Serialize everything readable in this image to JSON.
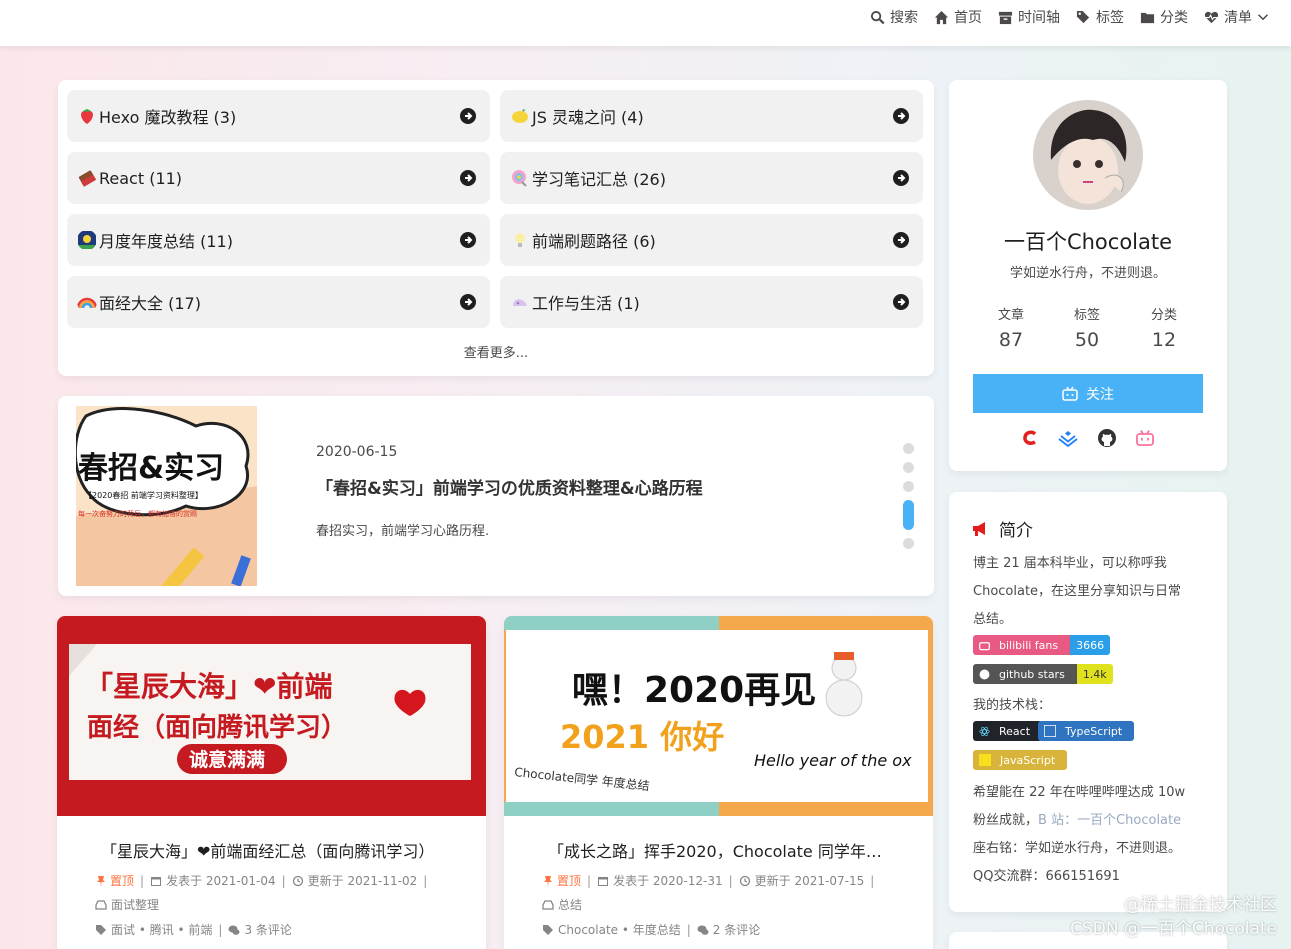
{
  "nav": {
    "items": [
      {
        "label": "搜索",
        "icon": "search-icon"
      },
      {
        "label": "首页",
        "icon": "home-icon"
      },
      {
        "label": "时间轴",
        "icon": "archive-icon"
      },
      {
        "label": "标签",
        "icon": "tags-icon"
      },
      {
        "label": "分类",
        "icon": "folder-icon"
      },
      {
        "label": "清单",
        "icon": "heartbeat-icon"
      }
    ]
  },
  "categories": {
    "items": [
      {
        "label": "Hexo 魔改教程 (3)",
        "icon": "strawberry-icon",
        "color": "#e8383d"
      },
      {
        "label": "JS 灵魂之问 (4)",
        "icon": "lemon-icon",
        "color": "#f5d33a"
      },
      {
        "label": "React (11)",
        "icon": "chocolate-icon",
        "color": "#8a4b2a"
      },
      {
        "label": "学习笔记汇总 (26)",
        "icon": "lollipop-icon",
        "color": "#e86aa7"
      },
      {
        "label": "月度年度总结 (11)",
        "icon": "firework-icon",
        "color": "#3a6fd8"
      },
      {
        "label": "前端刷题路径 (6)",
        "icon": "bulb-icon",
        "color": "#f5e27a"
      },
      {
        "label": "面经大全 (17)",
        "icon": "rainbow-icon",
        "color": "#f08a3c"
      },
      {
        "label": "工作与生活 (1)",
        "icon": "shell-icon",
        "color": "#c9a6e8"
      }
    ],
    "more": "查看更多..."
  },
  "slider": {
    "date": "2020-06-15",
    "title": "「春招&实习」前端学习の优质资料整理&心路历程",
    "desc": "春招实习，前端学习心路历程.",
    "cover_title": "春招&实习",
    "cover_sub": "【2020春招 前端学习资料整理】",
    "cover_line": "每一次奋努力的背后，都有加倍的赏赐"
  },
  "posts": [
    {
      "cover_line1": "「星辰大海」❤前端",
      "cover_line2": "面经（面向腾讯学习）",
      "cover_line3": "诚意满满",
      "title": "「星辰大海」❤前端面经汇总（面向腾讯学习）",
      "sticky": "置顶",
      "published": "发表于 2021-01-04",
      "updated": "更新于 2021-11-02",
      "category": "面试整理",
      "tags": "面试 • 腾讯 • 前端",
      "comments": "3 条评论"
    },
    {
      "cover_line1": "嘿！2020再见",
      "cover_line2": "2021 你好",
      "cover_line3": "Hello year of the ox",
      "cover_line4": "Chocolate同学 年度总结",
      "title": "「成长之路」挥手2020，Chocolate 同学年度总结",
      "sticky": "置顶",
      "published": "发表于 2020-12-31",
      "updated": "更新于 2021-07-15",
      "category": "总结",
      "tags": "Chocolate • 年度总结",
      "comments": "2 条评论"
    }
  ],
  "profile": {
    "name": "一百个Chocolate",
    "desc": "学如逆水行舟，不进则退。",
    "stats": [
      {
        "label": "文章",
        "value": "87"
      },
      {
        "label": "标签",
        "value": "50"
      },
      {
        "label": "分类",
        "value": "12"
      }
    ],
    "follow": "关注",
    "accent": "#49b1f5"
  },
  "intro": {
    "title": "简介",
    "p1": "博主 21 届本科毕业，可以称呼我",
    "p2": "Chocolate，在这里分享知识与日常",
    "p3": "总结。",
    "badge_bili_label": "bilibili fans",
    "badge_bili_value": "3666",
    "badge_gh_label": "github stars",
    "badge_gh_value": "1.4k",
    "stack_label": "我的技术栈：",
    "stack": [
      "React",
      "TypeScript",
      "JavaScript"
    ],
    "p4": "希望能在 22 年在哔哩哔哩达成 10w",
    "p5a": "粉丝成就，",
    "p5b": "B 站：一百个Chocolate",
    "p6": "座右铭：学如逆水行舟，不进则退。",
    "p7": "QQ交流群：666151691"
  },
  "watermark": {
    "line1": "@稀土掘金技术社区",
    "line2": "CSDN @一百个Chocolate"
  }
}
